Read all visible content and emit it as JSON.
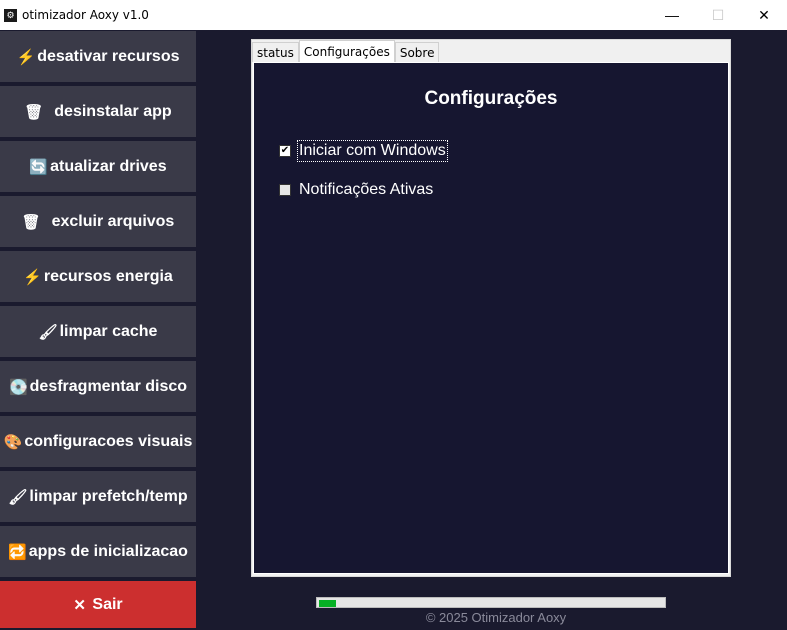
{
  "window": {
    "title": "otimizador Aoxy v1.0",
    "minimize_glyph": "—",
    "maximize_glyph": "☐",
    "close_glyph": "✕"
  },
  "sidebar": {
    "items": [
      {
        "label": "desativar recursos",
        "icon": "lightning-icon",
        "glyph": "⚡"
      },
      {
        "label": "desinstalar app",
        "icon": "trash-icon",
        "glyph": "🗑"
      },
      {
        "label": "atualizar drives",
        "icon": "refresh-icon",
        "glyph": "🔄"
      },
      {
        "label": "excluir arquivos",
        "icon": "trash-icon",
        "glyph": "🗑"
      },
      {
        "label": "recursos energia",
        "icon": "lightning-icon",
        "glyph": "⚡"
      },
      {
        "label": "limpar cache",
        "icon": "brush-icon",
        "glyph": "🖌"
      },
      {
        "label": "desfragmentar disco",
        "icon": "disk-icon",
        "glyph": "💽"
      },
      {
        "label": "configuracoes visuais",
        "icon": "palette-icon",
        "glyph": "🎨"
      },
      {
        "label": "limpar prefetch/temp",
        "icon": "brush-icon",
        "glyph": "🖌"
      },
      {
        "label": "apps de inicializacao",
        "icon": "startup-icon",
        "glyph": "🔁"
      }
    ],
    "exit": {
      "label": "Sair",
      "glyph": "✕"
    }
  },
  "tabs": [
    {
      "label": "status"
    },
    {
      "label": "Configurações"
    },
    {
      "label": "Sobre"
    }
  ],
  "active_tab": "Configurações",
  "settings": {
    "title": "Configurações",
    "options": [
      {
        "label": "Iniciar com Windows",
        "checked": true
      },
      {
        "label": "Notificações Ativas",
        "checked": false
      }
    ]
  },
  "progress": {
    "value_fraction": 0.05,
    "color": "#06b025"
  },
  "footer": "© 2025 Otimizador Aoxy",
  "colors": {
    "sidebar_button": "#3a3a48",
    "exit_button": "#cc2f2f",
    "background": "#1a1a2e"
  }
}
